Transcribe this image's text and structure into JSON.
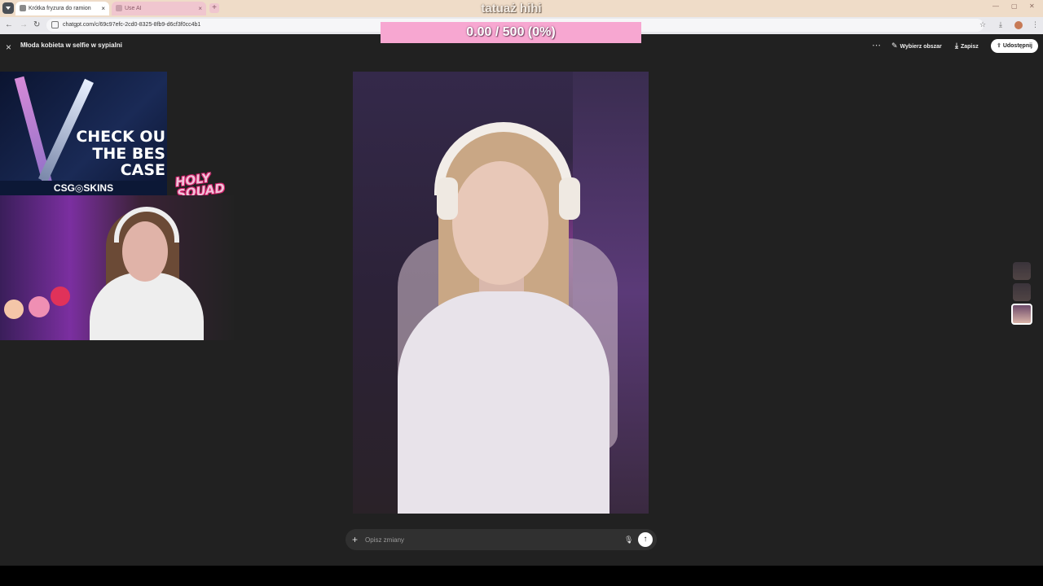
{
  "browser": {
    "tabs": [
      {
        "title": "Krótka fryzura do ramion",
        "active": true
      },
      {
        "title": "Use AI",
        "active": false
      }
    ],
    "new_tab_icon": "+",
    "url": "chatgpt.com/c/69c97efc-2cd0-8325-8fb9-d6cf3f0cc4b1"
  },
  "overlay": {
    "title": "tatuaż hihi",
    "progress_text": "0.00 / 500 (0%)",
    "progress_fraction": 0.0
  },
  "header": {
    "close_icon": "×",
    "title": "Młoda kobieta w selfie w sypialni",
    "more_icon": "⋯",
    "select_area_label": "Wybierz obszar",
    "save_label": "Zapisz",
    "share_label": "Udostępnij"
  },
  "promo": {
    "line1": "CHECK OU",
    "line2": "THE BES",
    "line3": "CASE",
    "brand": "CSG◎SKINS",
    "squad_line1": "HOLY",
    "squad_line2": "SQUAD"
  },
  "composer": {
    "plus_icon": "+",
    "placeholder": "Opisz zmiany",
    "mic_icon": "🎙",
    "send_icon": "↑"
  },
  "colors": {
    "accent_progress": "#f7a7d1",
    "app_background": "#212121",
    "titlebar": "#efdcc8"
  }
}
